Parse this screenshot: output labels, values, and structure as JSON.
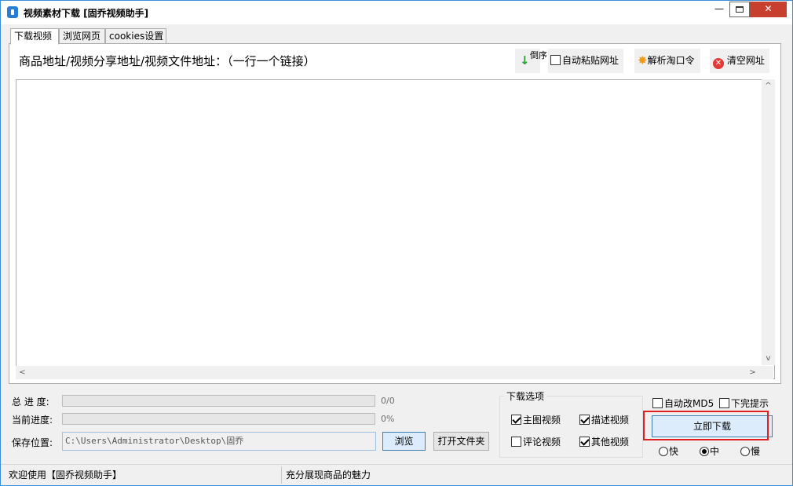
{
  "window": {
    "title": "视频素材下载 [固乔视频助手]",
    "controls": {
      "minimize": "—",
      "maximize": "",
      "close": "✕"
    }
  },
  "tabs": [
    {
      "label": "下载视频",
      "active": true
    },
    {
      "label": "浏览网页",
      "active": false
    },
    {
      "label": "cookies设置",
      "active": false
    }
  ],
  "panel": {
    "url_label": "商品地址/视频分享地址/视频文件地址：（一行一个链接）",
    "reverse_label": "倒序",
    "auto_paste": {
      "label": "自动粘贴网址",
      "checked": false
    },
    "parse_label": "解析淘口令",
    "clear_label": "清空网址",
    "textarea_value": ""
  },
  "progress": {
    "total_label": "总 进 度:",
    "total_text": "0/0",
    "total_fraction": 0,
    "current_label": "当前进度:",
    "current_text": "0%",
    "current_fraction": 0
  },
  "save": {
    "label": "保存位置:",
    "path": "C:\\Users\\Administrator\\Desktop\\固乔",
    "browse_label": "浏览",
    "open_folder_label": "打开文件夹"
  },
  "download_options": {
    "title": "下载选项",
    "main_video": {
      "label": "主图视频",
      "checked": true
    },
    "desc_video": {
      "label": "描述视频",
      "checked": true
    },
    "comment_video": {
      "label": "评论视频",
      "checked": false
    },
    "other_video": {
      "label": "其他视频",
      "checked": true
    }
  },
  "right_panel": {
    "auto_md5": {
      "label": "自动改MD5",
      "checked": false
    },
    "done_tip": {
      "label": "下完提示",
      "checked": false
    },
    "download_label": "立即下载",
    "speed": [
      {
        "label": "快",
        "checked": false
      },
      {
        "label": "中",
        "checked": true
      },
      {
        "label": "慢",
        "checked": false
      }
    ]
  },
  "status": {
    "left": "欢迎使用【固乔视频助手】",
    "right": "充分展现商品的魅力"
  },
  "colors": {
    "title_close_bg": "#c7402f",
    "progress_fill": "#06b025",
    "highlight_border": "#e02020"
  }
}
